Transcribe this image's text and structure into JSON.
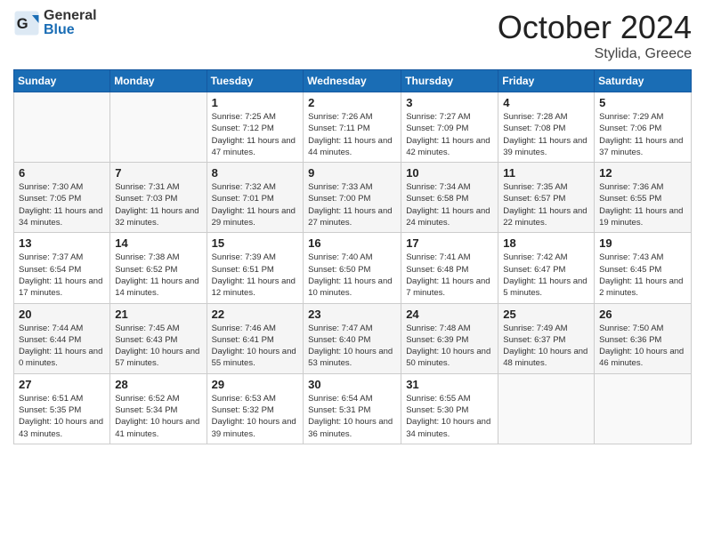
{
  "header": {
    "logo_general": "General",
    "logo_blue": "Blue",
    "month": "October 2024",
    "location": "Stylida, Greece"
  },
  "days_of_week": [
    "Sunday",
    "Monday",
    "Tuesday",
    "Wednesday",
    "Thursday",
    "Friday",
    "Saturday"
  ],
  "weeks": [
    [
      {
        "day": "",
        "info": ""
      },
      {
        "day": "",
        "info": ""
      },
      {
        "day": "1",
        "info": "Sunrise: 7:25 AM\nSunset: 7:12 PM\nDaylight: 11 hours and 47 minutes."
      },
      {
        "day": "2",
        "info": "Sunrise: 7:26 AM\nSunset: 7:11 PM\nDaylight: 11 hours and 44 minutes."
      },
      {
        "day": "3",
        "info": "Sunrise: 7:27 AM\nSunset: 7:09 PM\nDaylight: 11 hours and 42 minutes."
      },
      {
        "day": "4",
        "info": "Sunrise: 7:28 AM\nSunset: 7:08 PM\nDaylight: 11 hours and 39 minutes."
      },
      {
        "day": "5",
        "info": "Sunrise: 7:29 AM\nSunset: 7:06 PM\nDaylight: 11 hours and 37 minutes."
      }
    ],
    [
      {
        "day": "6",
        "info": "Sunrise: 7:30 AM\nSunset: 7:05 PM\nDaylight: 11 hours and 34 minutes."
      },
      {
        "day": "7",
        "info": "Sunrise: 7:31 AM\nSunset: 7:03 PM\nDaylight: 11 hours and 32 minutes."
      },
      {
        "day": "8",
        "info": "Sunrise: 7:32 AM\nSunset: 7:01 PM\nDaylight: 11 hours and 29 minutes."
      },
      {
        "day": "9",
        "info": "Sunrise: 7:33 AM\nSunset: 7:00 PM\nDaylight: 11 hours and 27 minutes."
      },
      {
        "day": "10",
        "info": "Sunrise: 7:34 AM\nSunset: 6:58 PM\nDaylight: 11 hours and 24 minutes."
      },
      {
        "day": "11",
        "info": "Sunrise: 7:35 AM\nSunset: 6:57 PM\nDaylight: 11 hours and 22 minutes."
      },
      {
        "day": "12",
        "info": "Sunrise: 7:36 AM\nSunset: 6:55 PM\nDaylight: 11 hours and 19 minutes."
      }
    ],
    [
      {
        "day": "13",
        "info": "Sunrise: 7:37 AM\nSunset: 6:54 PM\nDaylight: 11 hours and 17 minutes."
      },
      {
        "day": "14",
        "info": "Sunrise: 7:38 AM\nSunset: 6:52 PM\nDaylight: 11 hours and 14 minutes."
      },
      {
        "day": "15",
        "info": "Sunrise: 7:39 AM\nSunset: 6:51 PM\nDaylight: 11 hours and 12 minutes."
      },
      {
        "day": "16",
        "info": "Sunrise: 7:40 AM\nSunset: 6:50 PM\nDaylight: 11 hours and 10 minutes."
      },
      {
        "day": "17",
        "info": "Sunrise: 7:41 AM\nSunset: 6:48 PM\nDaylight: 11 hours and 7 minutes."
      },
      {
        "day": "18",
        "info": "Sunrise: 7:42 AM\nSunset: 6:47 PM\nDaylight: 11 hours and 5 minutes."
      },
      {
        "day": "19",
        "info": "Sunrise: 7:43 AM\nSunset: 6:45 PM\nDaylight: 11 hours and 2 minutes."
      }
    ],
    [
      {
        "day": "20",
        "info": "Sunrise: 7:44 AM\nSunset: 6:44 PM\nDaylight: 11 hours and 0 minutes."
      },
      {
        "day": "21",
        "info": "Sunrise: 7:45 AM\nSunset: 6:43 PM\nDaylight: 10 hours and 57 minutes."
      },
      {
        "day": "22",
        "info": "Sunrise: 7:46 AM\nSunset: 6:41 PM\nDaylight: 10 hours and 55 minutes."
      },
      {
        "day": "23",
        "info": "Sunrise: 7:47 AM\nSunset: 6:40 PM\nDaylight: 10 hours and 53 minutes."
      },
      {
        "day": "24",
        "info": "Sunrise: 7:48 AM\nSunset: 6:39 PM\nDaylight: 10 hours and 50 minutes."
      },
      {
        "day": "25",
        "info": "Sunrise: 7:49 AM\nSunset: 6:37 PM\nDaylight: 10 hours and 48 minutes."
      },
      {
        "day": "26",
        "info": "Sunrise: 7:50 AM\nSunset: 6:36 PM\nDaylight: 10 hours and 46 minutes."
      }
    ],
    [
      {
        "day": "27",
        "info": "Sunrise: 6:51 AM\nSunset: 5:35 PM\nDaylight: 10 hours and 43 minutes."
      },
      {
        "day": "28",
        "info": "Sunrise: 6:52 AM\nSunset: 5:34 PM\nDaylight: 10 hours and 41 minutes."
      },
      {
        "day": "29",
        "info": "Sunrise: 6:53 AM\nSunset: 5:32 PM\nDaylight: 10 hours and 39 minutes."
      },
      {
        "day": "30",
        "info": "Sunrise: 6:54 AM\nSunset: 5:31 PM\nDaylight: 10 hours and 36 minutes."
      },
      {
        "day": "31",
        "info": "Sunrise: 6:55 AM\nSunset: 5:30 PM\nDaylight: 10 hours and 34 minutes."
      },
      {
        "day": "",
        "info": ""
      },
      {
        "day": "",
        "info": ""
      }
    ]
  ]
}
